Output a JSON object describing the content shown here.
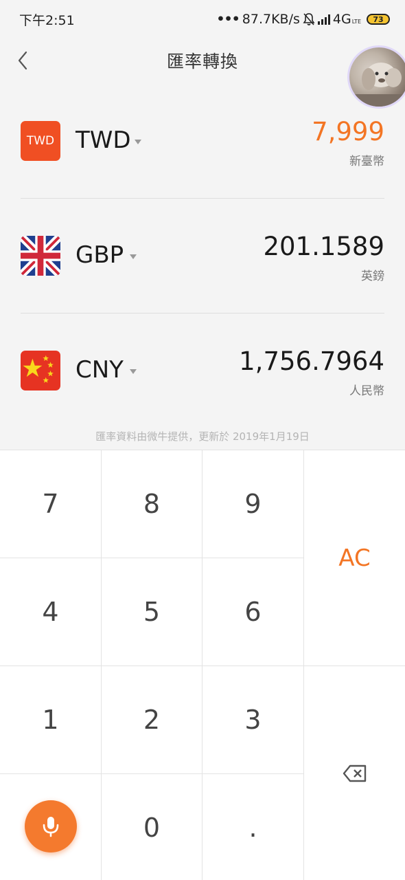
{
  "status_bar": {
    "time": "下午2:51",
    "dots": "•••",
    "network_speed": "87.7KB/s",
    "network_type": "4G",
    "network_sub": "LTE",
    "battery": "73"
  },
  "header": {
    "title": "匯率轉換"
  },
  "currencies": [
    {
      "code": "TWD",
      "flag_text": "TWD",
      "amount": "7,999",
      "name": "新臺幣",
      "active": true
    },
    {
      "code": "GBP",
      "amount": "201.1589",
      "name": "英鎊",
      "active": false
    },
    {
      "code": "CNY",
      "amount": "1,756.7964",
      "name": "人民幣",
      "active": false
    }
  ],
  "footnote": "匯率資料由微牛提供，更新於 2019年1月19日",
  "keypad": {
    "k7": "7",
    "k8": "8",
    "k9": "9",
    "k4": "4",
    "k5": "5",
    "k6": "6",
    "k1": "1",
    "k2": "2",
    "k3": "3",
    "k0": "0",
    "kdot": ".",
    "clear": "AC",
    "backspace_icon": "backspace-icon",
    "mic_icon": "microphone-icon"
  },
  "colors": {
    "accent": "#f37524",
    "twd_flag": "#f04f23"
  }
}
